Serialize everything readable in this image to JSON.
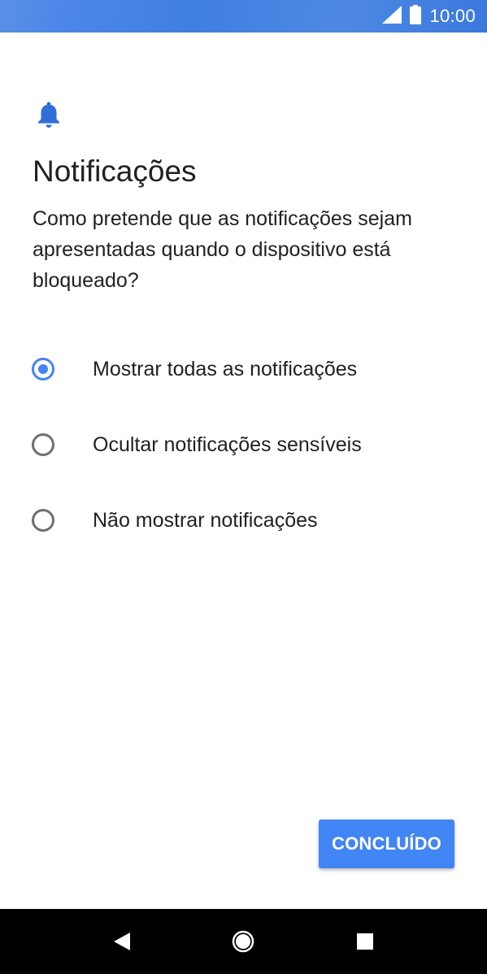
{
  "status_bar": {
    "time": "10:00",
    "icons": [
      "signal-icon",
      "battery-icon"
    ],
    "color": "#4a86e8"
  },
  "page": {
    "icon": "bell-icon",
    "title": "Notificações",
    "subtitle": "Como pretende que as notificações sejam apresentadas quando o dispositivo está bloqueado?"
  },
  "options": [
    {
      "label": "Mostrar todas as notificações",
      "selected": true
    },
    {
      "label": "Ocultar notificações sensíveis",
      "selected": false
    },
    {
      "label": "Não mostrar notificações",
      "selected": false
    }
  ],
  "actions": {
    "done_label": "CONCLUÍDO"
  },
  "nav_bar": {
    "buttons": [
      "back-icon",
      "home-icon",
      "recents-icon"
    ]
  },
  "colors": {
    "accent": "#4285f4",
    "text": "#212121",
    "radio_off": "#6f6f6f"
  }
}
